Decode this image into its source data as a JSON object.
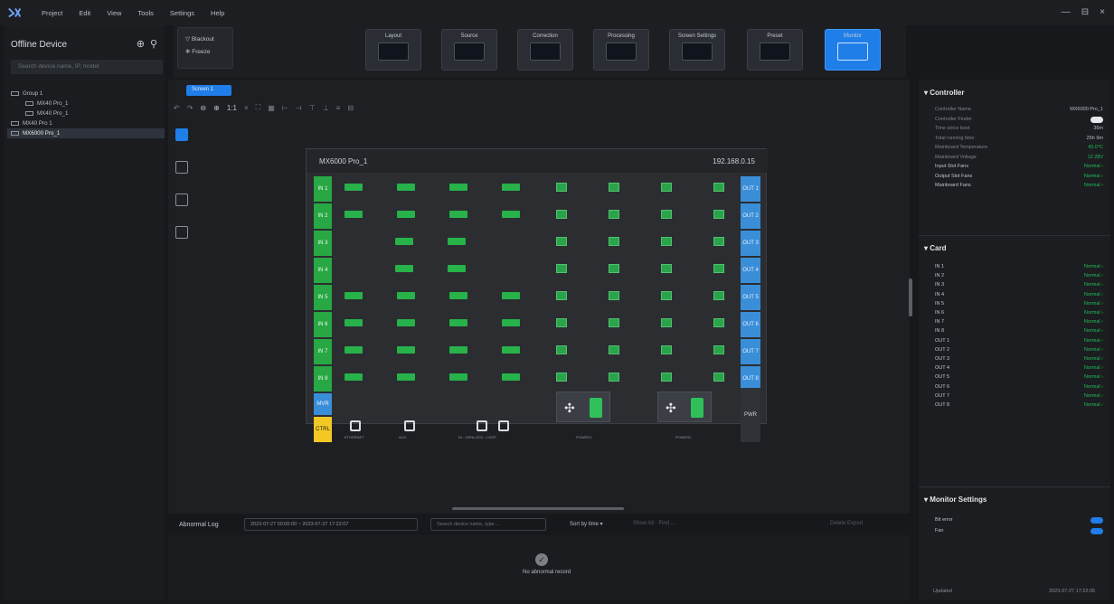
{
  "menu": {
    "items": [
      "Project",
      "Edit",
      "View",
      "Tools",
      "Settings",
      "Help"
    ],
    "window_controls": [
      "—",
      "⊟",
      "×"
    ]
  },
  "left": {
    "title": "Offline Device",
    "search_placeholder": "Search device name, IP, model",
    "tree": [
      {
        "label": "Group 1",
        "indent": 0
      },
      {
        "label": "MX40 Pro_1",
        "indent": 1
      },
      {
        "label": "MX40 Pro_1",
        "indent": 1
      },
      {
        "label": "MX40 Pro 1",
        "indent": 0
      },
      {
        "label": "MX6000 Pro_1",
        "indent": 0,
        "selected": true
      }
    ]
  },
  "toolbar": {
    "blackout": "Blackout",
    "freeze": "Freeze",
    "buttons": [
      "Layout",
      "Source",
      "Correction",
      "Processing",
      "Screen Settings",
      "Preset",
      "Monitor"
    ],
    "active": "Monitor"
  },
  "screen_tab": "Screen 1",
  "device": {
    "name": "MX6000 Pro_1",
    "ip": "192.168.0.15",
    "inputs": [
      "IN 1",
      "IN 2",
      "IN 3",
      "IN 4",
      "IN 5",
      "IN 6",
      "IN 7",
      "IN 8"
    ],
    "outputs": [
      "OUT 1",
      "OUT 2",
      "OUT 3",
      "OUT 4",
      "OUT 5",
      "OUT 6",
      "OUT 7",
      "OUT 8"
    ],
    "mvr": "MVR",
    "ctrl": "CTRL",
    "pwr": "PWR",
    "bottom_labels": [
      "ETHERNET",
      "AUX",
      "IN - GENLOCK - LOOP",
      "POWER1",
      "POWER2"
    ]
  },
  "log": {
    "label": "Abnormal Log",
    "date_range": "2023-07-27 00:00:00 ~ 2023-07-27 17:22:07",
    "search_placeholder": "Search device name, type ...",
    "sort": "Sort by time ▾",
    "options": "Show All · Find ...",
    "actions": "Delete  Export",
    "empty": "No abnormal record"
  },
  "controller": {
    "title": "Controller",
    "rows": [
      {
        "k": "Controller Name",
        "v": "MX6000 Pro_1",
        "bright": false,
        "green": false
      },
      {
        "k": "Controller Finder",
        "v": "",
        "bright": false,
        "green": false
      },
      {
        "k": "Time since boot",
        "v": "36m",
        "bright": false,
        "green": false
      },
      {
        "k": "Total running time",
        "v": "25h 9m",
        "bright": false,
        "green": false
      },
      {
        "k": "Mainboard Temperature",
        "v": "43.0°C",
        "bright": false,
        "green": true
      },
      {
        "k": "Mainboard Voltage",
        "v": "12.28V",
        "bright": false,
        "green": true
      },
      {
        "k": "Input Slot Fans",
        "v": "Normal ›",
        "bright": true,
        "green": true
      },
      {
        "k": "Output Slot Fans",
        "v": "Normal ›",
        "bright": true,
        "green": true
      },
      {
        "k": "Mainboard Fans",
        "v": "Normal ›",
        "bright": true,
        "green": true
      }
    ]
  },
  "card": {
    "title": "Card",
    "rows": [
      {
        "k": "IN 1",
        "v": "Normal ›"
      },
      {
        "k": "IN 2",
        "v": "Normal ›"
      },
      {
        "k": "IN 3",
        "v": "Normal ›"
      },
      {
        "k": "IN 4",
        "v": "Normal ›"
      },
      {
        "k": "IN 5",
        "v": "Normal ›"
      },
      {
        "k": "IN 6",
        "v": "Normal ›"
      },
      {
        "k": "IN 7",
        "v": "Normal ›"
      },
      {
        "k": "IN 8",
        "v": "Normal ›"
      },
      {
        "k": "OUT 1",
        "v": "Normal ›"
      },
      {
        "k": "OUT 2",
        "v": "Normal ›"
      },
      {
        "k": "OUT 3",
        "v": "Normal ›"
      },
      {
        "k": "OUT 4",
        "v": "Normal ›"
      },
      {
        "k": "OUT 5",
        "v": "Normal ›"
      },
      {
        "k": "OUT 6",
        "v": "Normal ›"
      },
      {
        "k": "OUT 7",
        "v": "Normal ›"
      },
      {
        "k": "OUT 8",
        "v": "Normal ›"
      }
    ]
  },
  "monitor": {
    "title": "Monitor Settings",
    "rows": [
      {
        "k": "Bit error",
        "on": true
      },
      {
        "k": "Fan",
        "on": true
      }
    ]
  },
  "updated": {
    "k": "Updated",
    "v": "2023-07-27 17:22:05"
  },
  "colors": {
    "accent": "#1f7ee8",
    "green": "#1fbe57",
    "yellow": "#f3c824"
  }
}
